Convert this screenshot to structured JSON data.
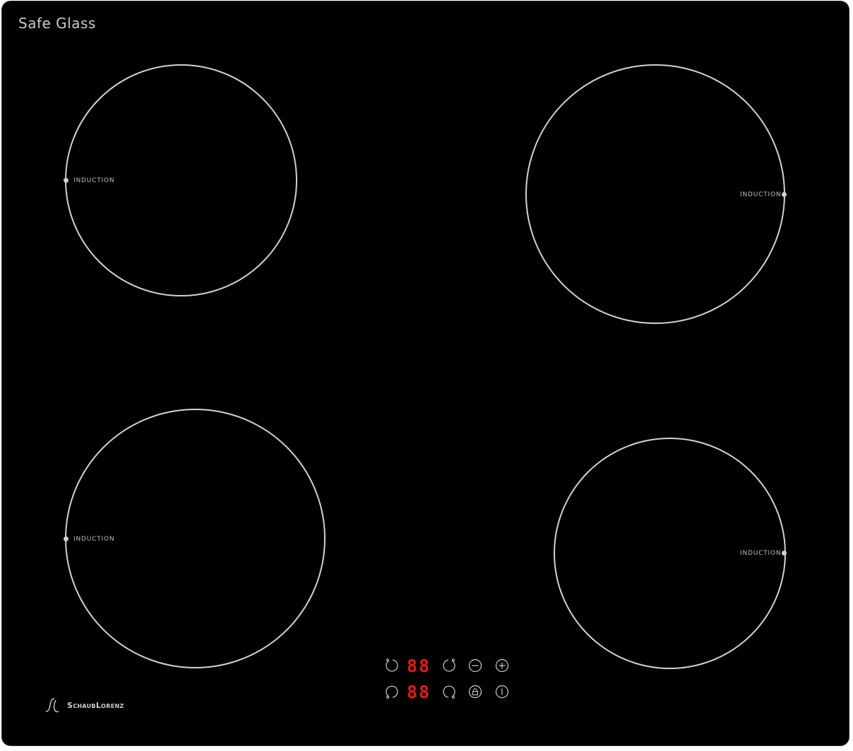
{
  "brand": {
    "top_text": "Safe Glass",
    "logo_text": "SchaubLorenz"
  },
  "zones": [
    {
      "id": "top-left",
      "label": "INDUCTION"
    },
    {
      "id": "top-right",
      "label": "INDUCTION"
    },
    {
      "id": "bottom-left",
      "label": "INDUCTION"
    },
    {
      "id": "bottom-right",
      "label": "INDUCTION"
    }
  ],
  "controls": {
    "display_top": "88",
    "display_bottom": "88"
  },
  "colors": {
    "panel": "#000000",
    "ring": "#d2d2d2",
    "display": "#e01a1a",
    "text": "#c9c9c9"
  },
  "icons": {
    "zone_select_top_left": "zone-rotate-left-icon",
    "zone_select_top_right": "zone-rotate-right-icon",
    "zone_select_bottom_left": "zone-rotate-left-bottom-icon",
    "zone_select_bottom_right": "zone-rotate-right-bottom-icon",
    "minus": "minus-icon",
    "plus": "plus-icon",
    "lock": "lock-icon",
    "power": "power-icon"
  }
}
